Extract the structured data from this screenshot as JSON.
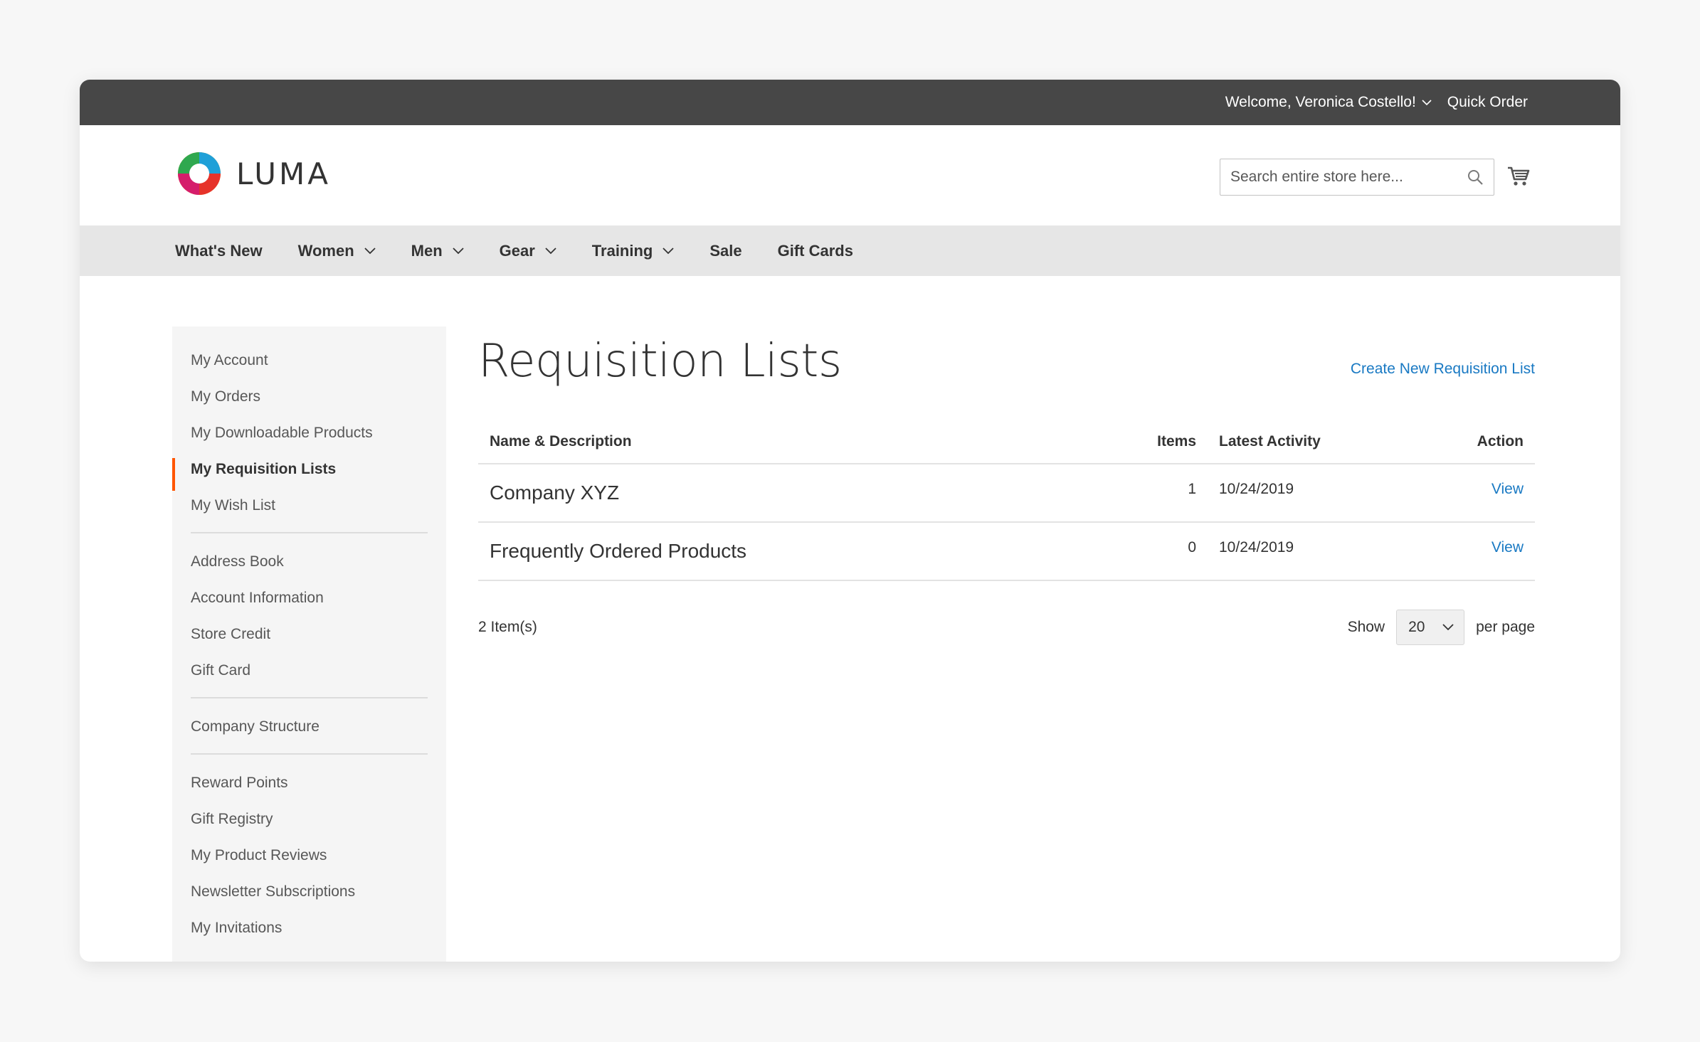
{
  "topbar": {
    "welcome": "Welcome, Veronica Costello!",
    "quick_order": "Quick Order"
  },
  "logo": {
    "text": "LUMA"
  },
  "search": {
    "placeholder": "Search entire store here..."
  },
  "nav": {
    "items": [
      {
        "label": "What's New"
      },
      {
        "label": "Women"
      },
      {
        "label": "Men"
      },
      {
        "label": "Gear"
      },
      {
        "label": "Training"
      },
      {
        "label": "Sale"
      },
      {
        "label": "Gift Cards"
      }
    ]
  },
  "sidebar": {
    "groups": [
      [
        "My Account",
        "My Orders",
        "My Downloadable Products",
        "My Requisition Lists",
        "My Wish List"
      ],
      [
        "Address Book",
        "Account Information",
        "Store Credit",
        "Gift Card"
      ],
      [
        "Company Structure"
      ],
      [
        "Reward Points",
        "Gift Registry",
        "My Product Reviews",
        "Newsletter Subscriptions",
        "My Invitations"
      ]
    ],
    "active": "My Requisition Lists"
  },
  "main": {
    "title": "Requisition Lists",
    "create_link": "Create New Requisition List",
    "columns": {
      "name": "Name & Description",
      "items": "Items",
      "latest": "Latest Activity",
      "action": "Action"
    },
    "rows": [
      {
        "name": "Company XYZ",
        "items": "1",
        "date": "10/24/2019",
        "action": "View"
      },
      {
        "name": "Frequently Ordered Products",
        "items": "0",
        "date": "10/24/2019",
        "action": "View"
      }
    ],
    "toolbar": {
      "amount": "2 Item(s)",
      "show": "Show",
      "limit": "20",
      "per_page": "per page"
    }
  },
  "colors": {
    "topbar": "#474747",
    "nav": "#e6e6e6",
    "link": "#1979c3",
    "active_marker": "#ff5501"
  }
}
